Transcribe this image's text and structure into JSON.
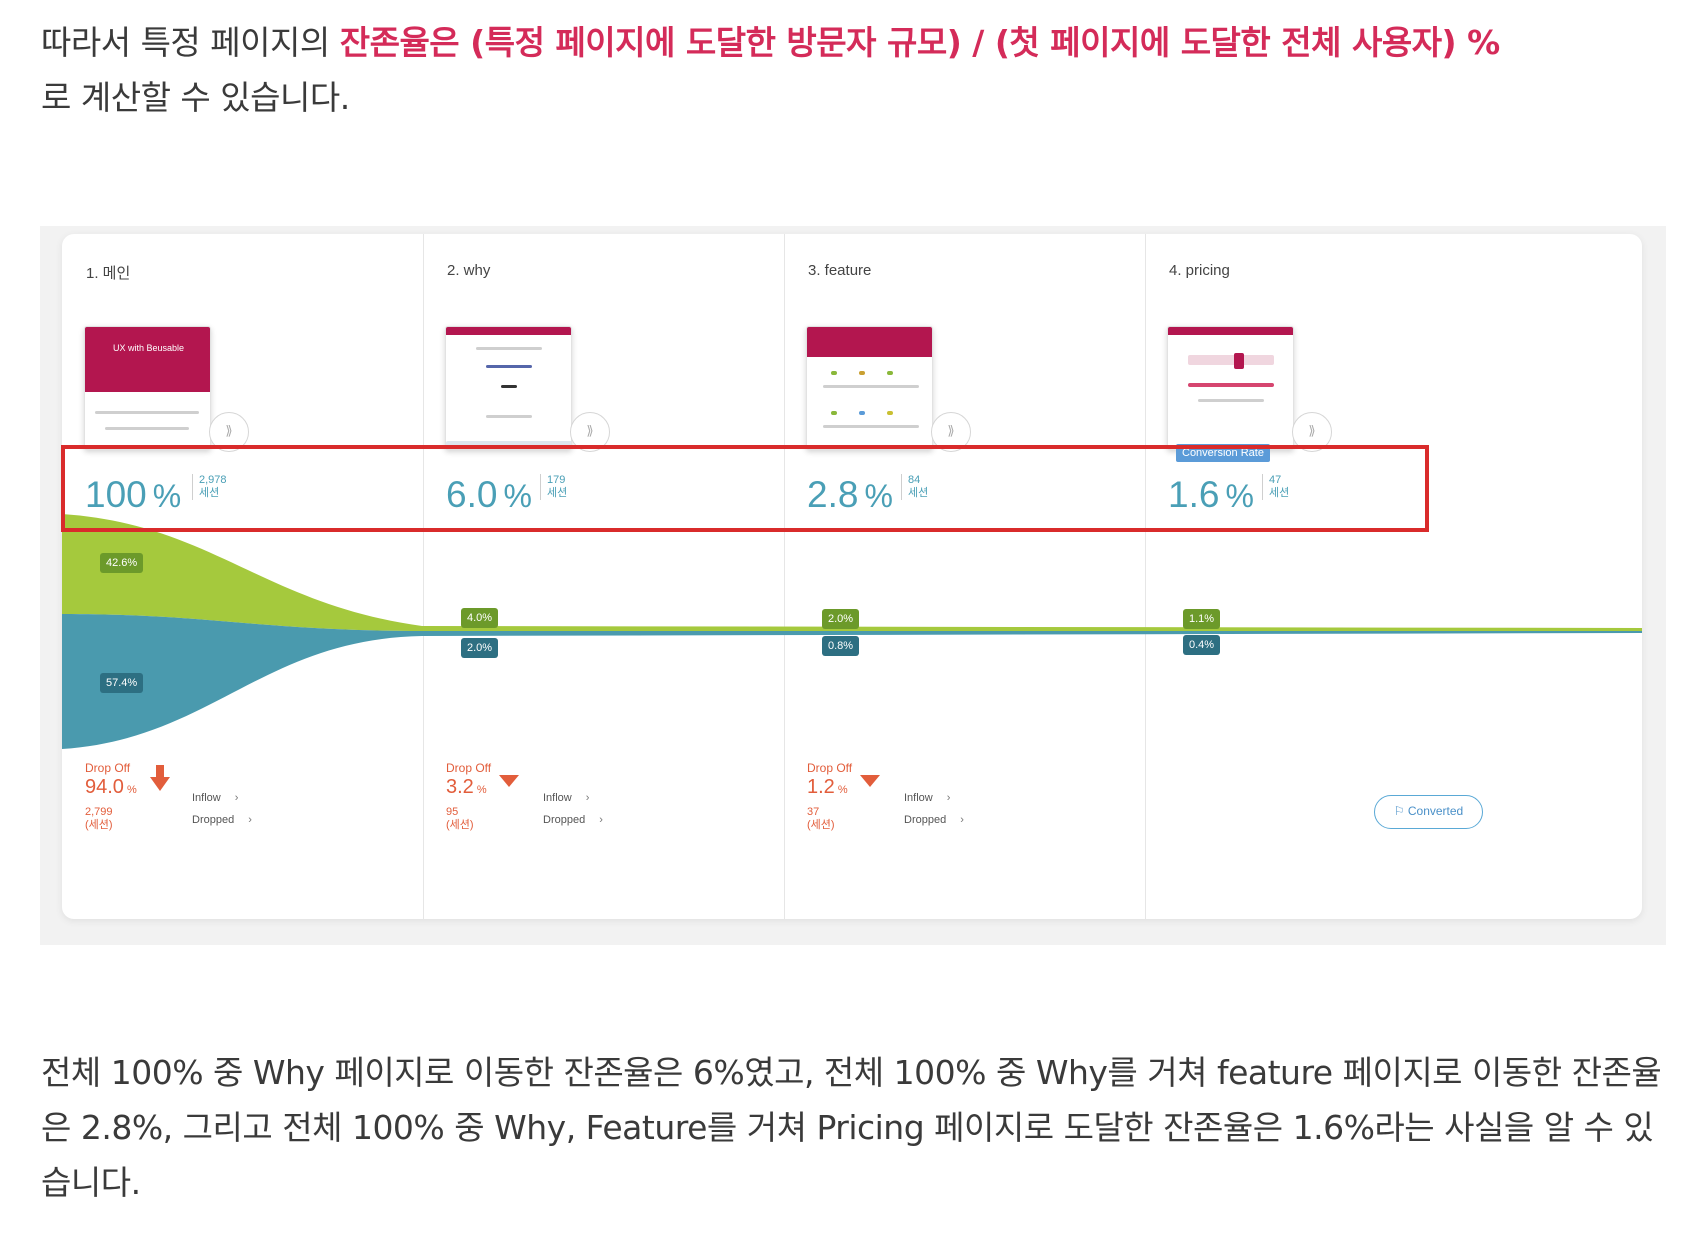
{
  "intro": {
    "normal_1": "따라서 특정 페이지의 ",
    "highlight": "잔존율은 (특정 페이지에 도달한 방문자 규모) / (첫 페이지에 도달한 전체 사용자) %",
    "normal_2": "로 계산할 수 있습니다."
  },
  "funnel": {
    "steps": [
      {
        "title": "1. 메인",
        "thumb_text": "UX with Beusable",
        "rate": "100",
        "unit": "%",
        "count": "2,978",
        "count_label": "세션",
        "label_green": "42.6%",
        "label_blue": "57.4%",
        "dropoff_title": "Drop Off",
        "dropoff_pct": "94.0",
        "dropoff_unit": "%",
        "dropoff_count": "2,799",
        "dropoff_count_label": "(세션)",
        "inflow": "Inflow",
        "dropped": "Dropped"
      },
      {
        "title": "2. why",
        "rate": "6.0",
        "unit": "%",
        "count": "179",
        "count_label": "세션",
        "label_green": "4.0%",
        "label_blue": "2.0%",
        "dropoff_title": "Drop Off",
        "dropoff_pct": "3.2",
        "dropoff_unit": "%",
        "dropoff_count": "95",
        "dropoff_count_label": "(세션)",
        "inflow": "Inflow",
        "dropped": "Dropped"
      },
      {
        "title": "3. feature",
        "rate": "2.8",
        "unit": "%",
        "count": "84",
        "count_label": "세션",
        "label_green": "2.0%",
        "label_blue": "0.8%",
        "dropoff_title": "Drop Off",
        "dropoff_pct": "1.2",
        "dropoff_unit": "%",
        "dropoff_count": "37",
        "dropoff_count_label": "(세션)",
        "inflow": "Inflow",
        "dropped": "Dropped"
      },
      {
        "title": "4. pricing",
        "conversion_badge": "Conversion Rate",
        "rate": "1.6",
        "unit": "%",
        "count": "47",
        "count_label": "세션",
        "label_green": "1.1%",
        "label_blue": "0.4%",
        "converted": "Converted"
      }
    ],
    "colors": {
      "green": "#a5c93d",
      "blue": "#4a9aae",
      "dropoff": "#e25d3b",
      "highlight_box": "#d92b2b"
    }
  },
  "summary": {
    "text": "전체 100% 중 Why 페이지로 이동한 잔존율은 6%였고, 전체 100% 중 Why를 거쳐 feature 페이지로 이동한 잔존율은 2.8%, 그리고 전체 100% 중 Why, Feature를 거쳐 Pricing 페이지로 도달한 잔존율은 1.6%라는 사실을 알 수 있습니다."
  }
}
